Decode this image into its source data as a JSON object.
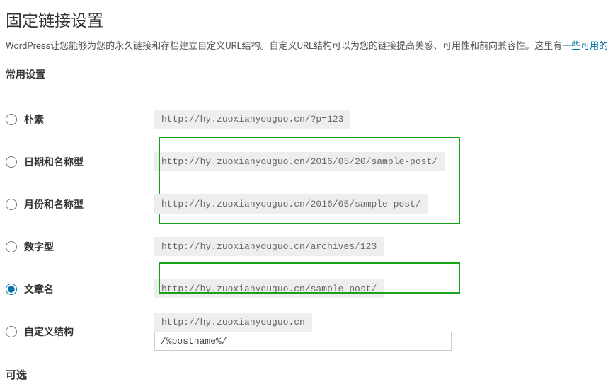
{
  "page_title": "固定链接设置",
  "description": {
    "text_before_link": "WordPress让您能够为您的永久链接和存档建立自定义URL结构。自定义URL结构可以为您的链接提高美感、可用性和前向兼容性。这里有",
    "link_text": "一些可用的"
  },
  "section_title": "常用设置",
  "options": [
    {
      "label": "朴素",
      "example": "http://hy.zuoxianyouguo.cn/?p=123",
      "selected": false
    },
    {
      "label": "日期和名称型",
      "example": "http://hy.zuoxianyouguo.cn/2016/05/20/sample-post/",
      "selected": false
    },
    {
      "label": "月份和名称型",
      "example": "http://hy.zuoxianyouguo.cn/2016/05/sample-post/",
      "selected": false
    },
    {
      "label": "数字型",
      "example": "http://hy.zuoxianyouguo.cn/archives/123",
      "selected": false
    },
    {
      "label": "文章名",
      "example": "http://hy.zuoxianyouguo.cn/sample-post/",
      "selected": true
    }
  ],
  "custom": {
    "label": "自定义结构",
    "base_url": "http://hy.zuoxianyouguo.cn",
    "value": "/%postname%/",
    "selected": false
  },
  "optional_heading": "可选"
}
